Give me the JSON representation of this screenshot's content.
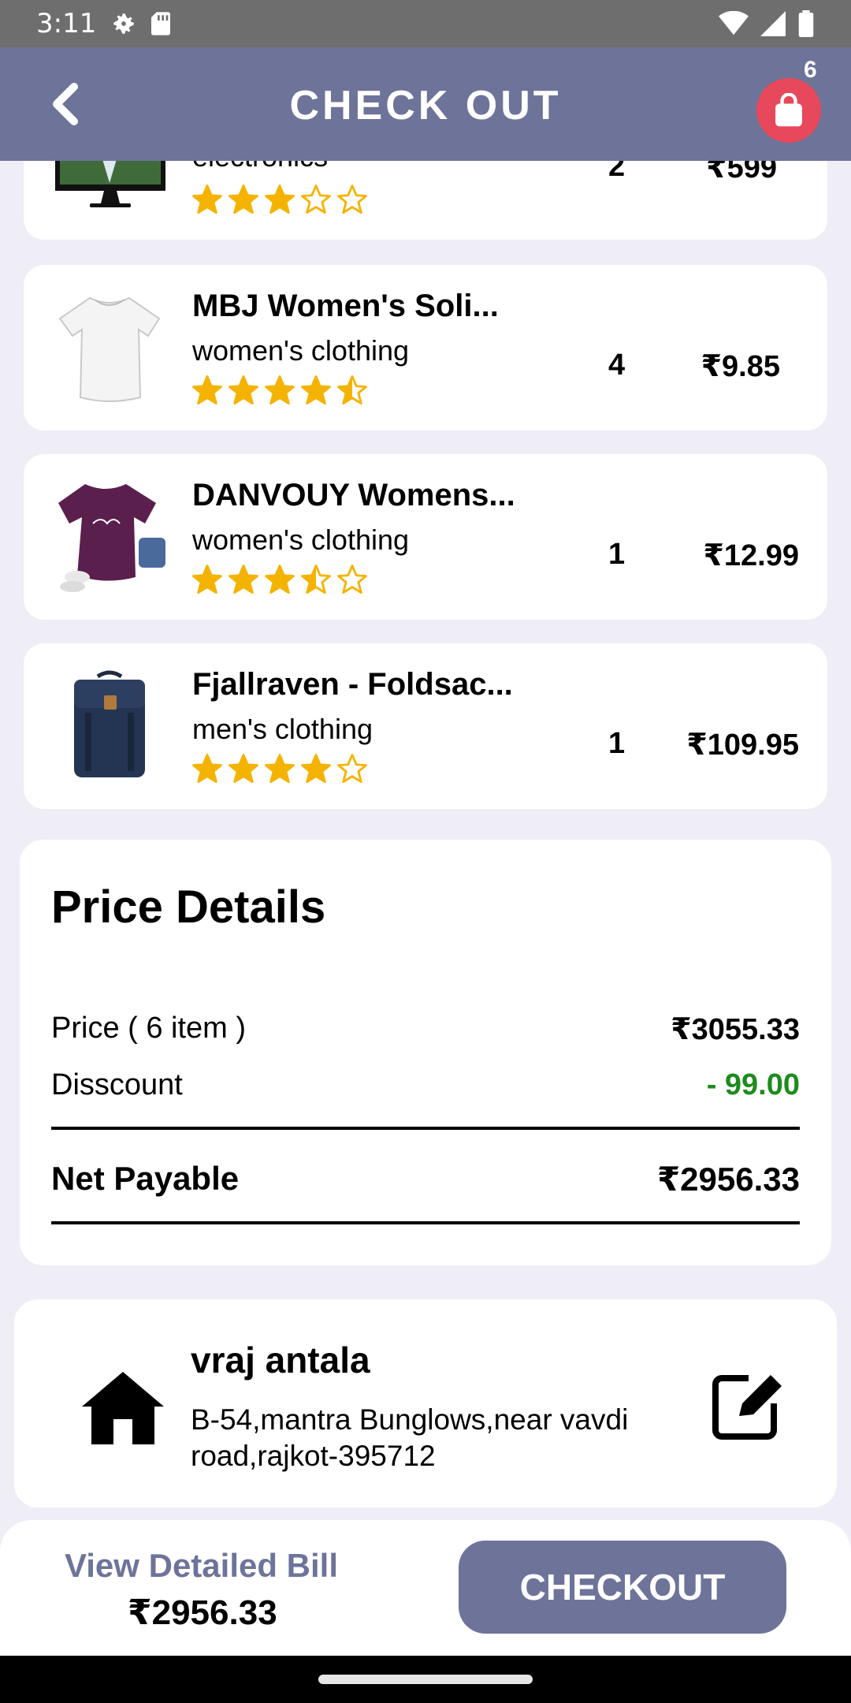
{
  "status_bar": {
    "time": "3:11"
  },
  "header": {
    "title": "CHECK OUT",
    "cart_count": "6"
  },
  "items": [
    {
      "name": "",
      "category": "electronics",
      "qty": "2",
      "price": "₹599",
      "rating": 3
    },
    {
      "name": "MBJ Women's Soli...",
      "category": "women's clothing",
      "qty": "4",
      "price": "₹9.85",
      "rating": 4.5
    },
    {
      "name": "DANVOUY Womens...",
      "category": "women's clothing",
      "qty": "1",
      "price": "₹12.99",
      "rating": 3.5
    },
    {
      "name": "Fjallraven - Foldsac...",
      "category": "men's clothing",
      "qty": "1",
      "price": "₹109.95",
      "rating": 4
    }
  ],
  "price_details": {
    "title": "Price Details",
    "price_label": "Price ( 6 item )",
    "price_value": "₹3055.33",
    "discount_label": "Disscount",
    "discount_value": "- 99.00",
    "net_label": "Net Payable",
    "net_value": "₹2956.33"
  },
  "address": {
    "name": "vraj antala",
    "line": "B-54,mantra Bunglows,near vavdi road,rajkot-395712"
  },
  "bottom": {
    "view_bill_label": "View Detailed Bill",
    "total": "₹2956.33",
    "checkout_label": "CHECKOUT"
  },
  "colors": {
    "accent": "#6e7399",
    "cart": "#e8485b",
    "star": "#f5b301",
    "discount": "#1e8b1e"
  }
}
